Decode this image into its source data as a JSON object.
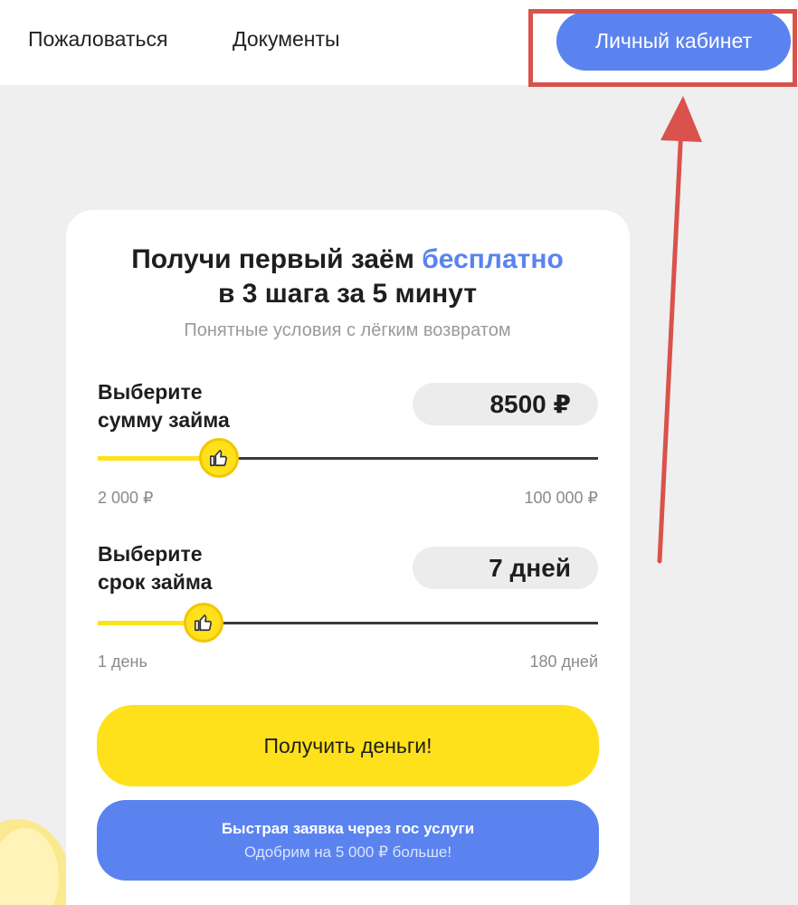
{
  "nav": {
    "complain": "Пожаловаться",
    "documents": "Документы",
    "cabinet": "Личный кабинет"
  },
  "hero": {
    "title_prefix": "Получи первый заём",
    "title_accent": "бесплатно",
    "title_line2": "в 3 шага за 5 минут",
    "subtitle": "Понятные условия с лёгким возвратом"
  },
  "amount": {
    "label_line1": "Выберите",
    "label_line2": "сумму займа",
    "value": "8500 ₽",
    "min_label": "2 000 ₽",
    "max_label": "100 000 ₽",
    "level": 0.066
  },
  "term": {
    "label_line1": "Выберите",
    "label_line2": "срок займа",
    "value": "7 дней",
    "min_label": "1 день",
    "max_label": "180 дней",
    "level": 0.034
  },
  "buttons": {
    "get_money": "Получить деньги!",
    "gos_primary": "Быстрая заявка через гос услуги",
    "gos_secondary": "Одобрим на 5 000 ₽ больше!"
  },
  "colors": {
    "accent_blue": "#5b83f0",
    "yellow": "#ffe11b",
    "annotation_red": "#d9524c"
  },
  "icons": {
    "slider_thumb": "thumbs-up-icon"
  }
}
